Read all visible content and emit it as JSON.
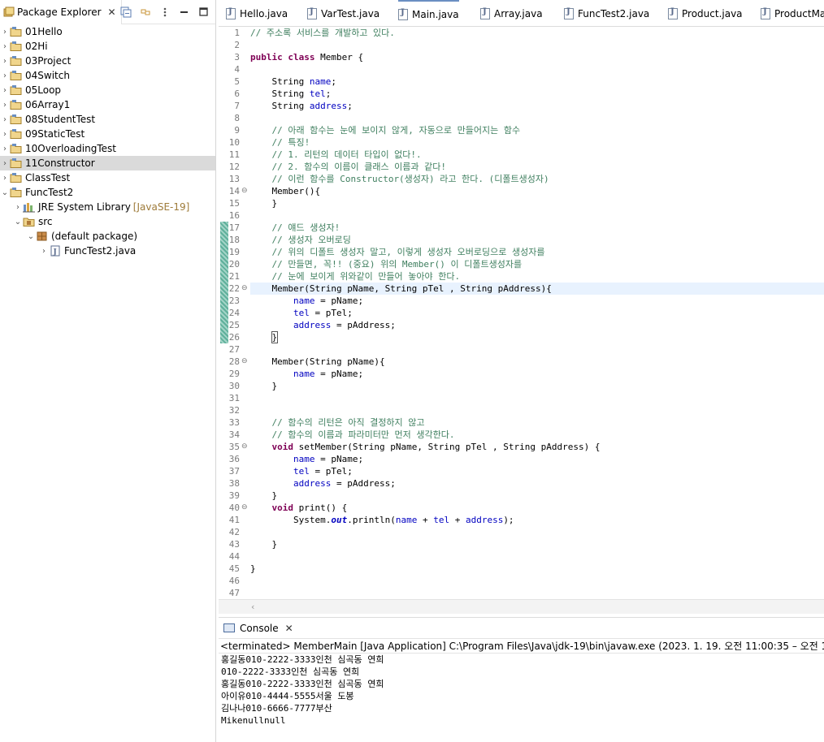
{
  "explorer": {
    "title": "Package Explorer",
    "items": [
      {
        "label": "01Hello",
        "twisty": "›",
        "level": 0
      },
      {
        "label": "02Hi",
        "twisty": "›",
        "level": 0
      },
      {
        "label": "03Project",
        "twisty": "›",
        "level": 0
      },
      {
        "label": "04Switch",
        "twisty": "›",
        "level": 0
      },
      {
        "label": "05Loop",
        "twisty": "›",
        "level": 0
      },
      {
        "label": "06Array1",
        "twisty": "›",
        "level": 0
      },
      {
        "label": "08StudentTest",
        "twisty": "›",
        "level": 0
      },
      {
        "label": "09StaticTest",
        "twisty": "›",
        "level": 0
      },
      {
        "label": "10OverloadingTest",
        "twisty": "›",
        "level": 0
      },
      {
        "label": "11Constructor",
        "twisty": "›",
        "level": 0,
        "selected": true
      },
      {
        "label": "ClassTest",
        "twisty": "›",
        "level": 0
      },
      {
        "label": "FuncTest2",
        "twisty": "⌄",
        "level": 0
      },
      {
        "label": "JRE System Library",
        "decor": "[JavaSE-19]",
        "twisty": "›",
        "level": 1
      },
      {
        "label": "src",
        "twisty": "⌄",
        "level": 1
      },
      {
        "label": "(default package)",
        "twisty": "⌄",
        "level": 2
      },
      {
        "label": "FuncTest2.java",
        "twisty": "›",
        "level": 3
      }
    ]
  },
  "editor_tabs": [
    "Hello.java",
    "VarTest.java",
    "Main.java",
    "Array.java",
    "FuncTest2.java",
    "Product.java",
    "ProductMa"
  ],
  "editor": {
    "line_numbers": [
      "1",
      "2",
      "3",
      "4",
      "5",
      "6",
      "7",
      "8",
      "9",
      "10",
      "11",
      "12",
      "13",
      "14",
      "15",
      "16",
      "17",
      "18",
      "19",
      "20",
      "21",
      "22",
      "23",
      "24",
      "25",
      "26",
      "27",
      "28",
      "29",
      "30",
      "31",
      "32",
      "33",
      "34",
      "35",
      "36",
      "37",
      "38",
      "39",
      "40",
      "41",
      "42",
      "43",
      "44",
      "45",
      "46",
      "47"
    ]
  },
  "console": {
    "title": "Console",
    "status": "<terminated> MemberMain [Java Application] C:\\Program Files\\Java\\jdk-19\\bin\\javaw.exe  (2023. 1. 19. 오전 11:00:35 – 오전 11:00:3",
    "lines": [
      "홍길동010-2222-3333인천 심곡동 연희",
      "010-2222-3333인천 심곡동 연희",
      "홍길동010-2222-3333인천 심곡동 연희",
      "아이유010-4444-5555서울 도봉",
      "김나나010-6666-7777부산",
      "Mikenullnull"
    ]
  },
  "colors": {
    "keyword": "#7f0055",
    "comment": "#3f7f5f",
    "field": "#0000c0",
    "current_line": "#e8f2fe",
    "selection": "#dadada"
  },
  "icons": [
    "project-folder-icon",
    "library-icon",
    "source-folder-icon",
    "package-icon",
    "java-file-icon",
    "console-icon",
    "collapse-all-icon",
    "link-editor-icon",
    "view-menu-icon",
    "minimize-icon",
    "maximize-icon",
    "close-icon"
  ]
}
